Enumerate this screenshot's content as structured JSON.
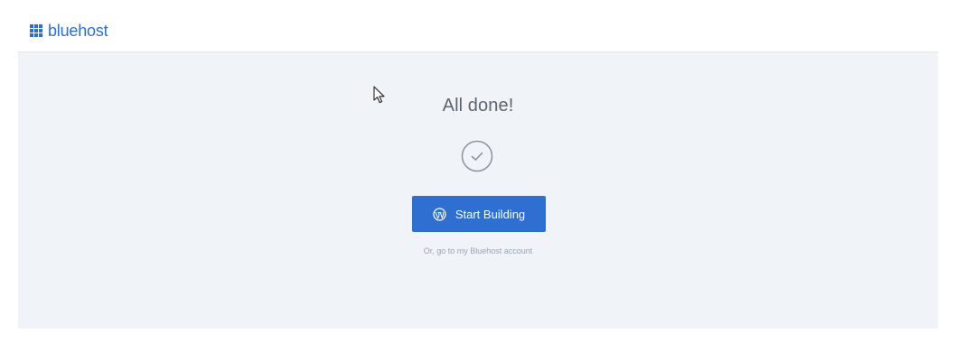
{
  "header": {
    "logo_text": "bluehost",
    "logo_icon": "grid-icon"
  },
  "main": {
    "title": "All done!",
    "status_icon": "check-circle-icon",
    "primary_button": {
      "label": "Start Building",
      "icon": "wordpress-icon"
    },
    "secondary_link": "Or, go to my Bluehost account"
  },
  "colors": {
    "brand": "#2f6fd1",
    "panel_bg": "#f0f3f7",
    "title_text": "#5d6570",
    "muted_text": "#9aa4b1"
  }
}
